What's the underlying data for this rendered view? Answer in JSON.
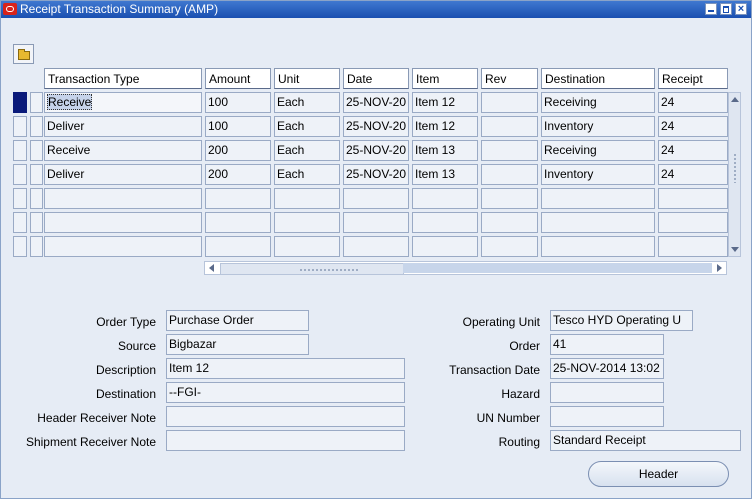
{
  "window": {
    "title": "Receipt Transaction Summary (AMP)",
    "controls": [
      "minimize-icon",
      "maximize-icon",
      "close-icon"
    ]
  },
  "toolbar": {
    "open_icon": "folder-open-icon"
  },
  "grid": {
    "columns": [
      "Transaction Type",
      "Amount",
      "Unit",
      "Date",
      "Item",
      "Rev",
      "Destination",
      "Receipt"
    ],
    "rows": [
      {
        "type": "Receive",
        "amount": "100",
        "unit": "Each",
        "date": "25-NOV-20",
        "item": "Item 12",
        "rev": "",
        "destination": "Receiving",
        "receipt": "24"
      },
      {
        "type": "Deliver",
        "amount": "100",
        "unit": "Each",
        "date": "25-NOV-20",
        "item": "Item 12",
        "rev": "",
        "destination": "Inventory",
        "receipt": "24"
      },
      {
        "type": "Receive",
        "amount": "200",
        "unit": "Each",
        "date": "25-NOV-20",
        "item": "Item 13",
        "rev": "",
        "destination": "Receiving",
        "receipt": "24"
      },
      {
        "type": "Deliver",
        "amount": "200",
        "unit": "Each",
        "date": "25-NOV-20",
        "item": "Item 13",
        "rev": "",
        "destination": "Inventory",
        "receipt": "24"
      },
      {
        "type": "",
        "amount": "",
        "unit": "",
        "date": "",
        "item": "",
        "rev": "",
        "destination": "",
        "receipt": ""
      },
      {
        "type": "",
        "amount": "",
        "unit": "",
        "date": "",
        "item": "",
        "rev": "",
        "destination": "",
        "receipt": ""
      },
      {
        "type": "",
        "amount": "",
        "unit": "",
        "date": "",
        "item": "",
        "rev": "",
        "destination": "",
        "receipt": ""
      }
    ]
  },
  "details": {
    "left": [
      {
        "label": "Order Type",
        "value": "Purchase Order"
      },
      {
        "label": "Source",
        "value": "Bigbazar"
      },
      {
        "label": "Description",
        "value": "Item 12"
      },
      {
        "label": "Destination",
        "value": "--FGI-"
      },
      {
        "label": "Header Receiver Note",
        "value": ""
      },
      {
        "label": "Shipment Receiver Note",
        "value": ""
      }
    ],
    "right": [
      {
        "label": "Operating Unit",
        "value": "Tesco HYD Operating U"
      },
      {
        "label": "Order",
        "value": "41"
      },
      {
        "label": "Transaction Date",
        "value": "25-NOV-2014 13:02"
      },
      {
        "label": "Hazard",
        "value": ""
      },
      {
        "label": "UN Number",
        "value": ""
      },
      {
        "label": "Routing",
        "value": "Standard Receipt"
      }
    ]
  },
  "buttons": {
    "header": "Header"
  }
}
